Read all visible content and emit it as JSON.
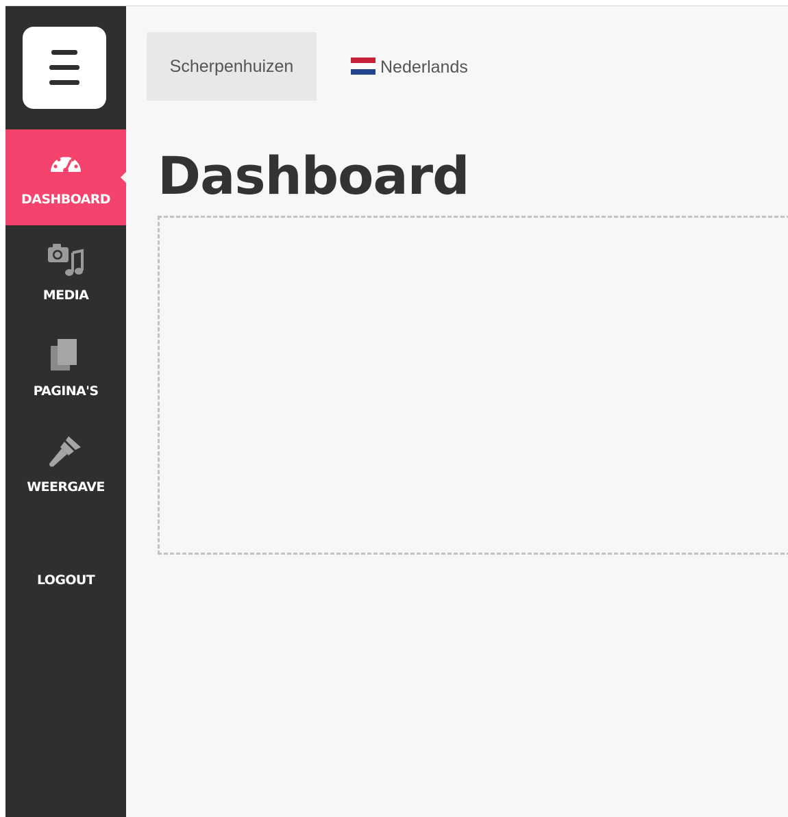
{
  "sidebar": {
    "menu_icon": "hamburger-icon",
    "items": [
      {
        "label": "DASHBOARD",
        "icon": "dashboard-gauge-icon",
        "active": true
      },
      {
        "label": "MEDIA",
        "icon": "camera-music-icon",
        "active": false
      },
      {
        "label": "PAGINA'S",
        "icon": "pages-icon",
        "active": false
      },
      {
        "label": "WEERGAVE",
        "icon": "paintbrush-icon",
        "active": false
      }
    ],
    "logout_label": "LOGOUT"
  },
  "header": {
    "site_name": "Scherpenhuizen",
    "language": "Nederlands",
    "language_flag": "netherlands-flag-icon"
  },
  "main": {
    "title": "Dashboard"
  },
  "colors": {
    "sidebar_bg": "#2f2f2f",
    "accent": "#f4436d",
    "page_bg": "#f7f7f7",
    "button_bg": "#e8e8e8"
  }
}
